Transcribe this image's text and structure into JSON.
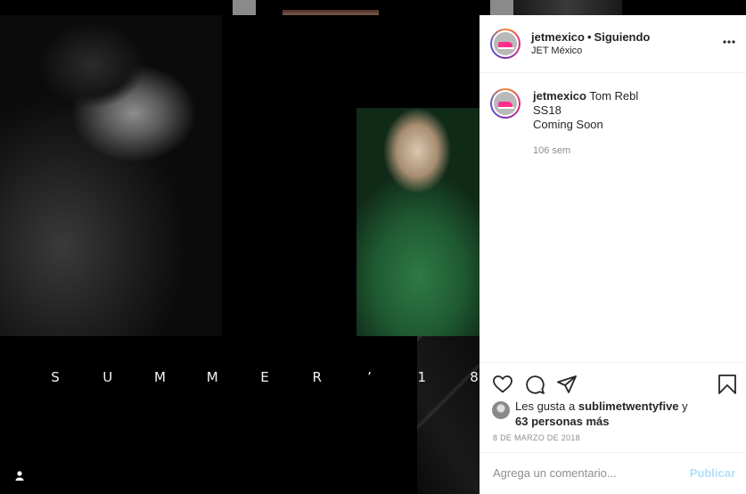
{
  "media": {
    "caption_letters": [
      "S",
      "U",
      "M",
      "M",
      "E",
      "R",
      "’",
      "1",
      "8"
    ]
  },
  "post": {
    "username": "jetmexico",
    "separator": "•",
    "follow_status": "Siguiendo",
    "location": "JET México",
    "more_icon": "more-horizontal-icon"
  },
  "comment": {
    "username": "jetmexico",
    "lines": [
      "Tom Rebl",
      "SS18",
      "Coming Soon"
    ],
    "time": "106 sem"
  },
  "actions": {
    "icons": [
      "heart-icon",
      "comment-icon",
      "share-icon",
      "bookmark-icon"
    ]
  },
  "likes": {
    "prefix": "Les gusta a",
    "user": "sublimetwentyfive",
    "connector": "y",
    "count_text": "63 personas más"
  },
  "date": "8 DE MARZO DE 2018",
  "add_comment": {
    "placeholder": "Agrega un comentario...",
    "publish": "Publicar"
  },
  "colors": {
    "publish_disabled": "#b2dffc",
    "muted": "#8e8e8e",
    "text": "#262626"
  }
}
